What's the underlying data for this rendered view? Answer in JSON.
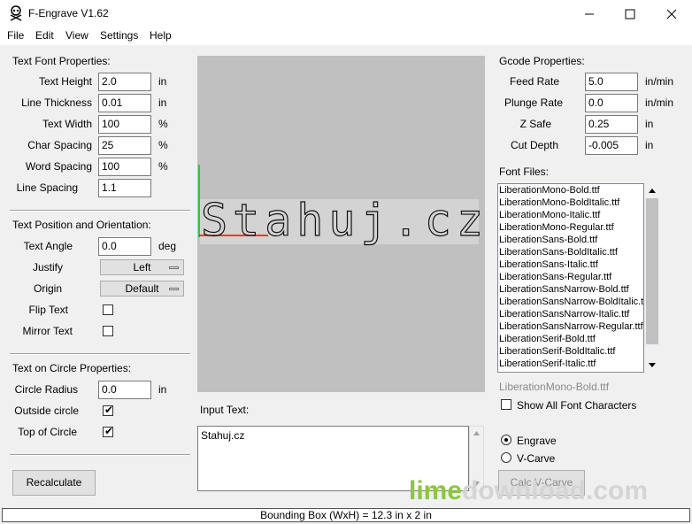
{
  "window": {
    "title": "F-Engrave V1.62"
  },
  "menu": [
    "File",
    "Edit",
    "View",
    "Settings",
    "Help"
  ],
  "text_font": {
    "heading": "Text Font Properties:",
    "fields": [
      {
        "label": "Text Height",
        "value": "2.0",
        "unit": "in"
      },
      {
        "label": "Line Thickness",
        "value": "0.01",
        "unit": "in"
      },
      {
        "label": "Text Width",
        "value": "100",
        "unit": "%"
      },
      {
        "label": "Char Spacing",
        "value": "25",
        "unit": "%"
      },
      {
        "label": "Word Spacing",
        "value": "100",
        "unit": "%"
      },
      {
        "label": "Line Spacing",
        "value": "1.1",
        "unit": ""
      }
    ]
  },
  "text_position": {
    "heading": "Text Position and Orientation:",
    "angle_label": "Text Angle",
    "angle_value": "0.0",
    "angle_unit": "deg",
    "justify_label": "Justify",
    "justify_value": "Left",
    "origin_label": "Origin",
    "origin_value": "Default",
    "flip_label": "Flip Text",
    "mirror_label": "Mirror Text"
  },
  "circle": {
    "heading": "Text on Circle Properties:",
    "radius_label": "Circle Radius",
    "radius_value": "0.0",
    "radius_unit": "in",
    "outside_label": "Outside circle",
    "top_label": "Top of Circle"
  },
  "recalculate_label": "Recalculate",
  "preview": {
    "text": "Stahuj.cz"
  },
  "input_text": {
    "label": "Input Text:",
    "value": "Stahuj.cz"
  },
  "gcode": {
    "heading": "Gcode Properties:",
    "fields": [
      {
        "label": "Feed Rate",
        "value": "5.0",
        "unit": "in/min"
      },
      {
        "label": "Plunge Rate",
        "value": "0.0",
        "unit": "in/min"
      },
      {
        "label": "Z Safe",
        "value": "0.25",
        "unit": "in"
      },
      {
        "label": "Cut Depth",
        "value": "-0.005",
        "unit": "in"
      }
    ]
  },
  "font_files": {
    "heading": "Font Files:",
    "items": [
      "LiberationMono-Bold.ttf",
      "LiberationMono-BoldItalic.ttf",
      "LiberationMono-Italic.ttf",
      "LiberationMono-Regular.ttf",
      "LiberationSans-Bold.ttf",
      "LiberationSans-BoldItalic.ttf",
      "LiberationSans-Italic.ttf",
      "LiberationSans-Regular.ttf",
      "LiberationSansNarrow-Bold.ttf",
      "LiberationSansNarrow-BoldItalic.ttf",
      "LiberationSansNarrow-Italic.ttf",
      "LiberationSansNarrow-Regular.ttf",
      "LiberationSerif-Bold.ttf",
      "LiberationSerif-BoldItalic.ttf",
      "LiberationSerif-Italic.ttf"
    ],
    "selected": "LiberationMono-Bold.ttf",
    "show_all_label": "Show All Font Characters"
  },
  "mode": {
    "engrave_label": "Engrave",
    "vcarve_label": "V-Carve",
    "calc_label": "Calc V-Carve"
  },
  "status": "Bounding Box (WxH) = 12.3 in  x 2 in",
  "watermark": {
    "lime": "lime",
    "rest": "download.com"
  },
  "colors": {
    "green": "#8dc63f",
    "gray": "#c0c0c0",
    "axis_x": "#ff0000",
    "axis_y": "#00cc00"
  }
}
